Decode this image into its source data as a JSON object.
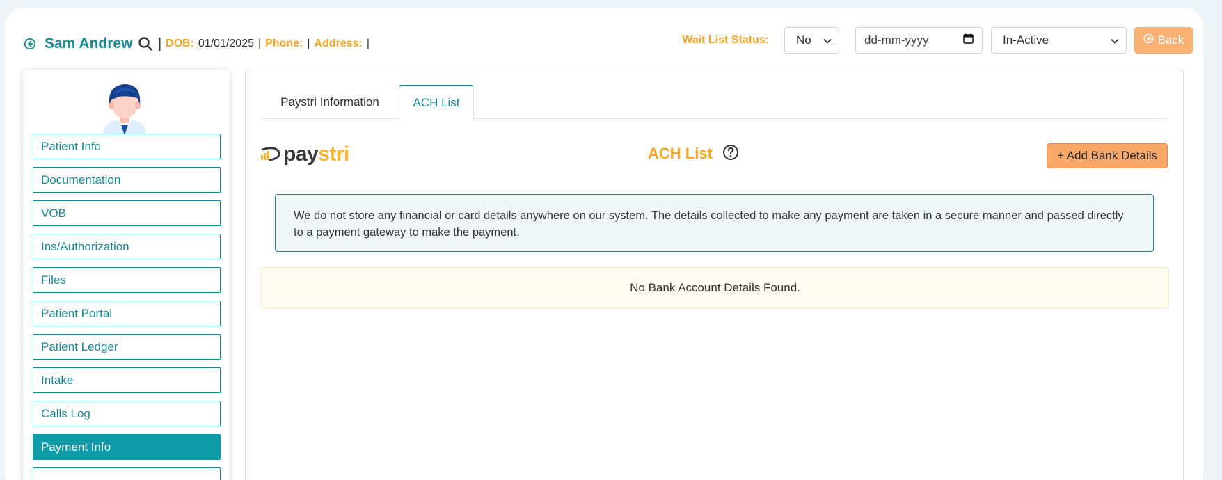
{
  "header": {
    "patient_name": "Sam Andrew",
    "separator": "|",
    "dob_label": "DOB:",
    "dob_value": "01/01/2025",
    "phone_label": "Phone:",
    "address_label": "Address:",
    "wait_list_label": "Wait List Status:",
    "wait_list_value": "No",
    "date_placeholder": "dd-mm-yyyy",
    "status_value": "In-Active",
    "back_label": "Back"
  },
  "sidebar": {
    "items": [
      {
        "label": "Patient Info"
      },
      {
        "label": "Documentation"
      },
      {
        "label": "VOB"
      },
      {
        "label": "Ins/Authorization"
      },
      {
        "label": "Files"
      },
      {
        "label": "Patient Portal"
      },
      {
        "label": "Patient Ledger"
      },
      {
        "label": "Intake"
      },
      {
        "label": "Calls Log"
      },
      {
        "label": "Payment Info"
      }
    ],
    "active_index": 9
  },
  "main": {
    "tabs": [
      {
        "label": "Paystri Information"
      },
      {
        "label": "ACH List"
      }
    ],
    "active_tab": 1,
    "logo": {
      "pay": "pay",
      "stri": "stri"
    },
    "title": "ACH List",
    "add_button": "+ Add Bank Details",
    "info_text": "We do not store any financial or card details anywhere on our system. The details collected to make any payment are taken in a secure manner and passed directly to a payment gateway to make the payment.",
    "empty_text": "No Bank Account Details Found."
  },
  "colors": {
    "teal": "#1a8a96",
    "orange": "#f5a623",
    "active_bg": "#0e9aa7",
    "button_orange": "#f9a869"
  },
  "icons": [
    "back-circle-icon",
    "search-icon",
    "chevron-down-icon",
    "calendar-icon",
    "help-circle-icon",
    "avatar"
  ]
}
